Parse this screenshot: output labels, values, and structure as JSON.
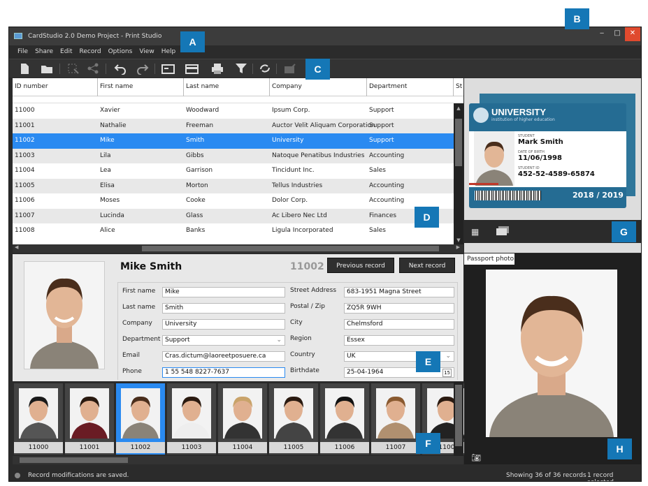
{
  "window": {
    "title": "CardStudio 2.0 Demo Project - Print Studio",
    "minimize": "‒",
    "maximize": "□",
    "close": "✕"
  },
  "menu": [
    "File",
    "Share",
    "Edit",
    "Record",
    "Options",
    "View",
    "Help"
  ],
  "toolbar": {
    "icons": [
      "new-document-icon",
      "open-folder-icon",
      "select-icon",
      "share-icon",
      "undo-icon",
      "redo-icon",
      "card-front-icon",
      "card-back-icon",
      "print-icon",
      "filter-icon",
      "sync-icon",
      "edit-card-icon"
    ]
  },
  "grid": {
    "columns": [
      "ID number",
      "First name",
      "Last name",
      "Company",
      "Department",
      "St"
    ],
    "rows": [
      [
        "11000",
        "Xavier",
        "Woodward",
        "Ipsum Corp.",
        "Support"
      ],
      [
        "11001",
        "Nathalie",
        "Freeman",
        "Auctor Velit Aliquam Corporation",
        "Support"
      ],
      [
        "11002",
        "Mike",
        "Smith",
        "University",
        "Support"
      ],
      [
        "11003",
        "Lila",
        "Gibbs",
        "Natoque Penatibus Industries",
        "Accounting"
      ],
      [
        "11004",
        "Lea",
        "Garrison",
        "Tincidunt Inc.",
        "Sales"
      ],
      [
        "11005",
        "Elisa",
        "Morton",
        "Tellus Industries",
        "Accounting"
      ],
      [
        "11006",
        "Moses",
        "Cooke",
        "Dolor Corp.",
        "Accounting"
      ],
      [
        "11007",
        "Lucinda",
        "Glass",
        "Ac Libero Nec Ltd",
        "Finances"
      ],
      [
        "11008",
        "Alice",
        "Banks",
        "Ligula Incorporated",
        "Sales"
      ]
    ],
    "selected_row": 2
  },
  "detail": {
    "name": "Mike  Smith",
    "id": "11002",
    "prev": "Previous record",
    "next": "Next record",
    "fields": {
      "first_name": {
        "label": "First name",
        "value": "Mike"
      },
      "last_name": {
        "label": "Last name",
        "value": "Smith"
      },
      "company": {
        "label": "Company",
        "value": "University"
      },
      "department": {
        "label": "Department",
        "value": "Support"
      },
      "email": {
        "label": "Email",
        "value": "Cras.dictum@laoreetposuere.ca"
      },
      "phone": {
        "label": "Phone",
        "value": "1 55 548 8227-7637"
      },
      "street": {
        "label": "Street Address",
        "value": "683-1951 Magna Street"
      },
      "postal": {
        "label": "Postal / Zip",
        "value": "ZQ5R 9WH"
      },
      "city": {
        "label": "City",
        "value": "Chelmsford"
      },
      "region": {
        "label": "Region",
        "value": "Essex"
      },
      "country": {
        "label": "Country",
        "value": "UK"
      },
      "birthdate": {
        "label": "Birthdate",
        "value": "25-04-1964",
        "cal": "15"
      }
    }
  },
  "thumbs": [
    "11000",
    "11001",
    "11002",
    "11003",
    "11004",
    "11005",
    "11006",
    "11007",
    "1100"
  ],
  "card": {
    "brand": "UNIVERSITY",
    "tagline": "institution of higher education",
    "student_label": "STUDENT",
    "student": "Mark Smith",
    "dob_label": "DATE OF BIRTH",
    "dob": "11/06/1998",
    "sid_label": "STUDENT ID",
    "sid": "452-52-4589-65874",
    "year": "2018 / 2019"
  },
  "passport": {
    "tab": "Passport photo"
  },
  "status": {
    "message": "Record modifications are saved.",
    "count": "Showing 36 of 36 records",
    "selection": "1 record selected"
  },
  "callouts": {
    "A": "A",
    "B": "B",
    "C": "C",
    "D": "D",
    "E": "E",
    "F": "F",
    "G": "G",
    "H": "H"
  },
  "colors": {
    "accent": "#2a8af1",
    "callout": "#1577b6",
    "close": "#e04a2e"
  }
}
